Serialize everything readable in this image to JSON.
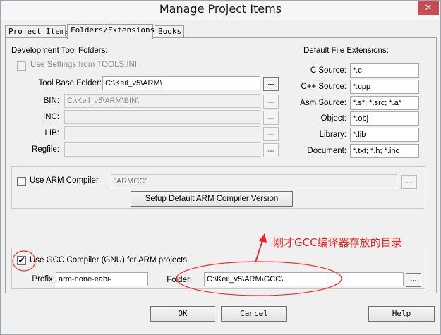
{
  "window": {
    "title": "Manage Project Items",
    "close_glyph": "✕"
  },
  "tabs": [
    "Project Items",
    "Folders/Extensions",
    "Books"
  ],
  "tool_folders": {
    "heading": "Development Tool Folders:",
    "use_settings_label": "Use Settings from TOOLS.INI:",
    "use_settings_checked": false,
    "tool_base_label": "Tool Base Folder:",
    "tool_base_value": "C:\\Keil_v5\\ARM\\",
    "bin_label": "BIN:",
    "bin_value": "C:\\Keil_v5\\ARM\\BIN\\",
    "inc_label": "INC:",
    "inc_value": "",
    "lib_label": "LIB:",
    "lib_value": "",
    "regfile_label": "Regfile:",
    "regfile_value": "",
    "browse_label": "..."
  },
  "extensions": {
    "heading": "Default File Extensions:",
    "rows": [
      {
        "label": "C Source:",
        "value": "*.c"
      },
      {
        "label": "C++ Source:",
        "value": "*.cpp"
      },
      {
        "label": "Asm Source:",
        "value": "*.s*; *.src; *.a*"
      },
      {
        "label": "Object:",
        "value": "*.obj"
      },
      {
        "label": "Library:",
        "value": "*.lib"
      },
      {
        "label": "Document:",
        "value": "*.txt; *.h; *.inc"
      }
    ]
  },
  "arm_compiler": {
    "use_label": "Use ARM Compiler",
    "checked": false,
    "value": "\"ARMCC\"",
    "setup_button": "Setup Default ARM Compiler Version",
    "browse_label": "..."
  },
  "gcc": {
    "use_label": "Use GCC Compiler (GNU) for ARM projects",
    "checked": true,
    "check_glyph": "✔",
    "prefix_label": "Prefix:",
    "prefix_value": "arm-none-eabi-",
    "folder_label": "Folder:",
    "folder_value": "C:\\Keil_v5\\ARM\\GCC\\",
    "browse_label": "..."
  },
  "annotation": {
    "text": "刚才GCC编译器存放的目录",
    "color": "#ff1f1f"
  },
  "footer": {
    "ok": "OK",
    "cancel": "Cancel",
    "help": "Help"
  }
}
